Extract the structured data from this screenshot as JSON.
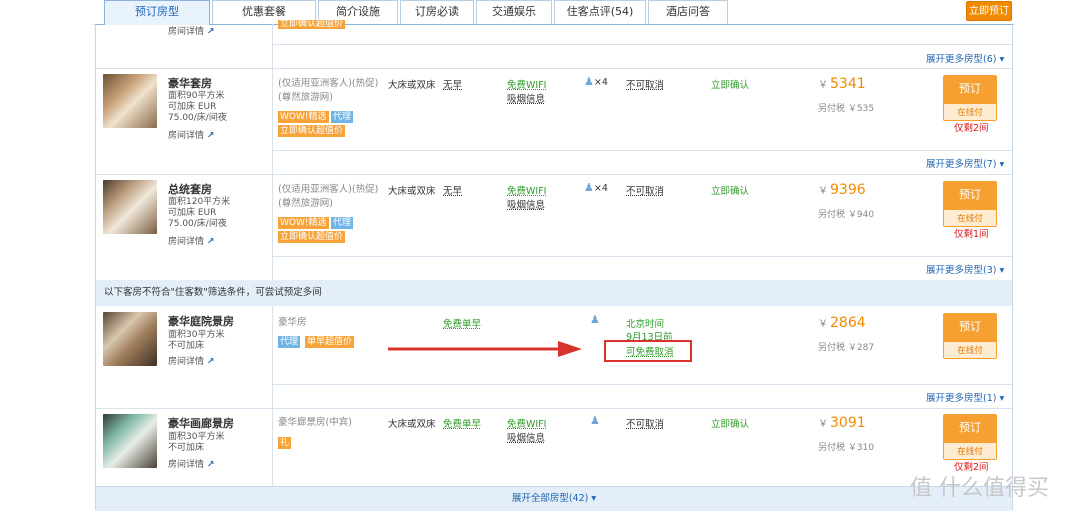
{
  "tabs": [
    "预订房型",
    "优惠套餐",
    "简介设施",
    "订房必读",
    "交通娱乐",
    "住客点评(54)",
    "酒店问答"
  ],
  "book_now": "立即预订",
  "top_partial": {
    "room_detail": "房间详情",
    "badge": "立即确认超值价"
  },
  "expand_labels": [
    "展开更多房型(6)",
    "展开更多房型(7)",
    "展开更多房型(3)",
    "展开更多房型(1)"
  ],
  "rooms": [
    {
      "name": "豪华套房",
      "area": "面积90平方米",
      "bed_extra": "可加床 EUR 75.00/床/间夜",
      "detail": "房间详情",
      "policy1": "(仅适用亚洲客人)(热促)",
      "policy2": "(尊然旅游网)",
      "bed": "大床或双床",
      "breakfast": "无早",
      "wifi": "免费WIFI",
      "smoke": "吸烟信息",
      "guests": "×4",
      "cancel": "不可取消",
      "confirm": "立即确认",
      "price": "5341",
      "tax": "另付税 ￥535",
      "book": "预订",
      "pay": "在线付",
      "left": "仅剩2间",
      "badges": [
        "WOW!精选",
        "代理",
        "立即确认超值价"
      ]
    },
    {
      "name": "总统套房",
      "area": "面积120平方米",
      "bed_extra": "可加床 EUR 75.00/床/间夜",
      "detail": "房间详情",
      "policy1": "(仅适用亚洲客人)(热促)",
      "policy2": "(尊然旅游网)",
      "bed": "大床或双床",
      "breakfast": "无早",
      "wifi": "免费WIFI",
      "smoke": "吸烟信息",
      "guests": "×4",
      "cancel": "不可取消",
      "confirm": "立即确认",
      "price": "9396",
      "tax": "另付税 ￥940",
      "book": "预订",
      "pay": "在线付",
      "left": "仅剩1间",
      "badges": [
        "WOW!精选",
        "代理",
        "立即确认超值价"
      ]
    },
    {
      "name": "豪华庭院景房",
      "area": "面积30平方米",
      "bed_extra": "不可加床",
      "detail": "房间详情",
      "policy1": "豪华房",
      "breakfast": "免费单早",
      "cancel1": "北京时间",
      "cancel2": "9月13日前",
      "cancel3": "可免费取消",
      "price": "2864",
      "tax": "另付税 ￥287",
      "book": "预订",
      "pay": "在线付",
      "badges": [
        "代理",
        "单早超值价"
      ]
    },
    {
      "name": "豪华画廊景房",
      "area": "面积30平方米",
      "bed_extra": "不可加床",
      "detail": "房间详情",
      "policy1": "豪华廊景房(中宾)",
      "bed": "大床或双床",
      "breakfast": "免费单早",
      "wifi": "免费WIFI",
      "smoke": "吸烟信息",
      "cancel": "不可取消",
      "confirm": "立即确认",
      "price": "3091",
      "tax": "另付税 ￥310",
      "book": "预订",
      "pay": "在线付",
      "left": "仅剩2间",
      "badges": [
        "礼"
      ]
    }
  ],
  "notice": "以下客房不符合\"住客数\"筛选条件，可尝试预定多间",
  "footer": "展开全部房型(42)",
  "currency": "￥",
  "watermark": "值 什么值得买",
  "colors": {
    "accent": "#f28a00",
    "link": "#2166b3",
    "green": "#2f9c2a",
    "red": "#d9191c",
    "arrow": "#d9342b"
  }
}
